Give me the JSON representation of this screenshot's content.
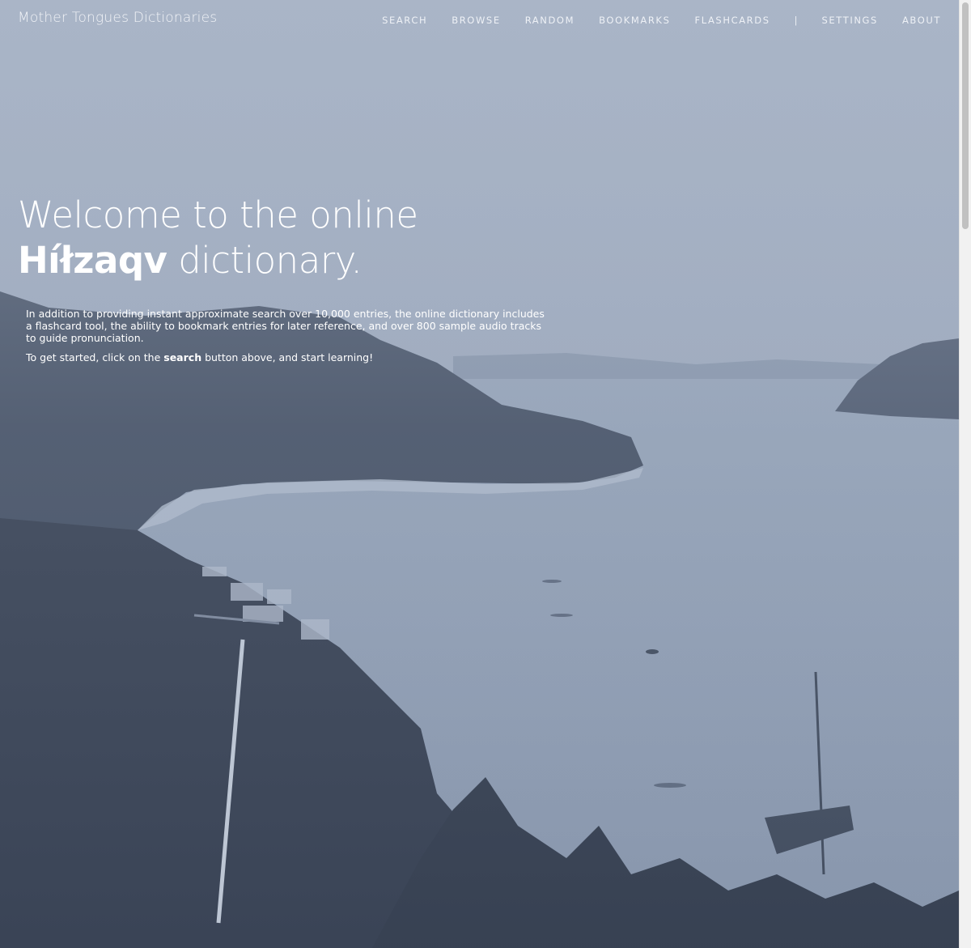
{
  "header": {
    "brand": "Mother Tongues Dictionaries",
    "nav": {
      "search": "SEARCH",
      "browse": "BROWSE",
      "random": "RANDOM",
      "bookmarks": "BOOKMARKS",
      "flashcards": "FLASHCARDS",
      "separator": "|",
      "settings": "SETTINGS",
      "about": "ABOUT"
    }
  },
  "hero": {
    "line1": "Welcome to the online",
    "language": "Híłzaqv",
    "line2_suffix": " dictionary."
  },
  "intro": {
    "paragraph1": "In addition to providing instant approximate search over 10,000 entries, the online dictionary includes a flashcard tool, the ability to bookmark entries for later reference, and over 800 sample audio tracks to guide pronunciation.",
    "p2_before": "To get started, click on the ",
    "p2_bold": "search",
    "p2_after": " button above, and start learning!"
  },
  "colors": {
    "tint": "#aab6c8",
    "text": "#ffffff",
    "water": "#8e9db3",
    "forest": "#3b4658"
  }
}
